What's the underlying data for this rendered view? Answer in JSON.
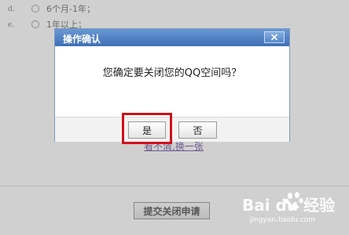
{
  "question": {
    "options": [
      {
        "letter": "d.",
        "label": "6个月-1年；"
      },
      {
        "letter": "e.",
        "label": "1年以上；"
      }
    ]
  },
  "captcha": {
    "link_text": "看不清,换一张"
  },
  "submit": {
    "label": "提交关闭申请"
  },
  "dialog": {
    "title": "操作确认",
    "message": "您确定要关闭您的QQ空间吗？",
    "yes_label": "是",
    "no_label": "否"
  },
  "watermark": {
    "brand": "Bai du 经验",
    "sub": "jingyan.baidu.com"
  },
  "colors": {
    "overlay": "#969696",
    "titlebar": "#3e6fb5",
    "highlight": "#d0111b",
    "link": "#4a2a8a"
  }
}
